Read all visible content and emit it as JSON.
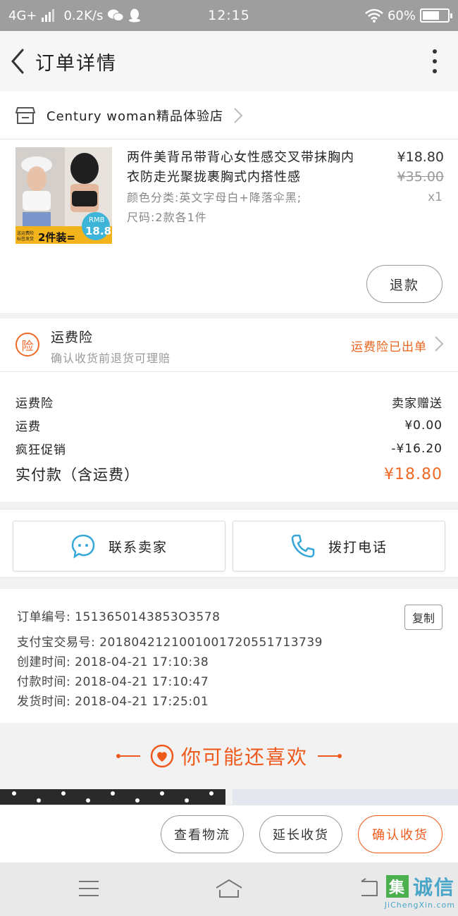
{
  "status_bar": {
    "network": "4G+",
    "speed": "0.2K/s",
    "time": "12:15",
    "battery": "60%"
  },
  "nav": {
    "title": "订单详情"
  },
  "shop": {
    "name": "Century woman精品体验店"
  },
  "item": {
    "title": "两件美背吊带背心女性感交叉带抹胸内衣防走光聚拢裹胸式内搭性感",
    "sku_color": "颜色分类:英文字母白+降落伞黑;",
    "sku_size": "尺码:2款各1件",
    "price": "¥18.80",
    "original_price": "¥35.00",
    "quantity": "x1",
    "refund_label": "退款",
    "thumb_badge_left_top": "送运费险",
    "thumb_badge_left_bottom": "标签发货",
    "thumb_badge_main": "2件装=",
    "thumb_badge_rmb": "RMB",
    "thumb_badge_price": "18.8"
  },
  "insurance": {
    "badge": "险",
    "title": "运费险",
    "subtitle": "确认收货前退货可理赔",
    "status": "运费险已出单"
  },
  "fees": [
    {
      "label": "运费险",
      "value": "卖家赠送"
    },
    {
      "label": "运费",
      "value": "¥0.00"
    },
    {
      "label": "疯狂促销",
      "value": "-¥16.20"
    }
  ],
  "total": {
    "label": "实付款（含运费）",
    "value": "¥18.80"
  },
  "contact": {
    "seller_label": "联系卖家",
    "phone_label": "拨打电话"
  },
  "order_info": {
    "order_no": "订单编号: 1513650143853O3578",
    "alipay_no": "支付宝交易号: 2018042121001001720551713739",
    "created": "创建时间: 2018-04-21  17:10:38",
    "paid": "付款时间: 2018-04-21  17:10:47",
    "shipped": "发货时间: 2018-04-21  17:25:01",
    "copy_label": "复制"
  },
  "recommend": {
    "title": "你可能还喜欢"
  },
  "bottom_actions": {
    "logistics": "查看物流",
    "extend": "延长收货",
    "confirm": "确认收货"
  },
  "watermark": {
    "box": "集",
    "cn": "诚信",
    "en": "JiChengXin.com"
  },
  "colors": {
    "accent": "#ef5a1c",
    "status_bar": "#9e9e9e",
    "icon_blue": "#36a7d8"
  }
}
